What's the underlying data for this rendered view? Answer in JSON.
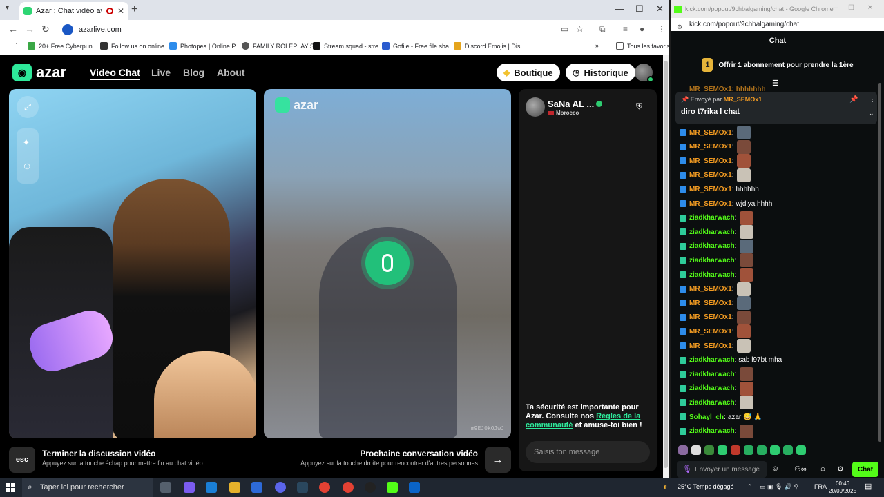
{
  "browser_left": {
    "tab_title": "Azar : Chat vidéo avec de n",
    "url": "azarlive.com",
    "bookmarks": [
      "20+ Free Cyberpun...",
      "Follow us on online...",
      "Photopea | Online P...",
      "FAMILY ROLEPLAY S...",
      "Stream squad - stre...",
      "Gofile - Free file sha...",
      "Discord Emojis | Dis..."
    ],
    "bookmarks_more": "»",
    "all_bookmarks": "Tous les favoris"
  },
  "azar": {
    "logo": "azar",
    "nav": [
      "Video Chat",
      "Live",
      "Blog",
      "About"
    ],
    "shop_label": "Boutique",
    "history_label": "Historique",
    "partner_name": "SaNa AL ...",
    "partner_country": "Morocco",
    "video_code": "m9EJ0kOJwJ",
    "safety_text_1": "Ta sécurité est importante pour Azar. Consulte nos ",
    "safety_link": "Règles de la communauté",
    "safety_text_2": " et amuse-toi bien !",
    "message_placeholder": "Saisis ton message",
    "esc_label": "esc",
    "end_title": "Terminer la discussion vidéo",
    "end_sub": "Appuyez sur la touche échap pour mettre fin au chat vidéo.",
    "next_title": "Prochaine conversation vidéo",
    "next_sub": "Appuyez sur la touche droite pour rencontrer d'autres personnes"
  },
  "browser_right": {
    "window_title": "kick.com/popout/9chbalgaming/chat - Google Chrome",
    "url": "kick.com/popout/9chbalgaming/chat",
    "chat_header": "Chat",
    "sub_badge": "1",
    "sub_offer": "Offrir 1 abonnement pour prendre la 1ère",
    "cut_line": "MR_SEMOx1: hhhhhhh",
    "pinned_by_label": "Envoyé par",
    "pinned_user": "MR_SEMOx1",
    "pinned_text": "diro t7rika l chat",
    "input_placeholder": "Envoyer un message",
    "chat_button": "Chat",
    "messages": [
      {
        "user": "MR_SEMOx1",
        "text": "",
        "emote": true,
        "color": "#f29b22"
      },
      {
        "user": "MR_SEMOx1",
        "text": "",
        "emote": true,
        "color": "#f29b22"
      },
      {
        "user": "MR_SEMOx1",
        "text": "",
        "emote": true,
        "color": "#f29b22"
      },
      {
        "user": "MR_SEMOx1",
        "text": "",
        "emote": true,
        "color": "#f29b22"
      },
      {
        "user": "MR_SEMOx1",
        "text": "hhhhhh",
        "emote": false,
        "color": "#f29b22"
      },
      {
        "user": "MR_SEMOx1",
        "text": "wjdiya hhhh",
        "emote": false,
        "color": "#f29b22"
      },
      {
        "user": "ziadkharwach",
        "text": "",
        "emote": true,
        "color": "#53fc18"
      },
      {
        "user": "ziadkharwach",
        "text": "",
        "emote": true,
        "color": "#53fc18"
      },
      {
        "user": "ziadkharwach",
        "text": "",
        "emote": true,
        "color": "#53fc18"
      },
      {
        "user": "ziadkharwach",
        "text": "",
        "emote": true,
        "color": "#53fc18"
      },
      {
        "user": "ziadkharwach",
        "text": "",
        "emote": true,
        "color": "#53fc18"
      },
      {
        "user": "MR_SEMOx1",
        "text": "",
        "emote": true,
        "color": "#f29b22"
      },
      {
        "user": "MR_SEMOx1",
        "text": "",
        "emote": true,
        "color": "#f29b22"
      },
      {
        "user": "MR_SEMOx1",
        "text": "",
        "emote": true,
        "color": "#f29b22"
      },
      {
        "user": "MR_SEMOx1",
        "text": "",
        "emote": true,
        "color": "#f29b22"
      },
      {
        "user": "MR_SEMOx1",
        "text": "",
        "emote": true,
        "color": "#f29b22"
      },
      {
        "user": "ziadkharwach",
        "text": "sab l97bt mha",
        "emote": false,
        "color": "#53fc18"
      },
      {
        "user": "ziadkharwach",
        "text": "",
        "emote": true,
        "color": "#53fc18"
      },
      {
        "user": "ziadkharwach",
        "text": "",
        "emote": true,
        "color": "#53fc18"
      },
      {
        "user": "ziadkharwach",
        "text": "",
        "emote": true,
        "color": "#53fc18"
      },
      {
        "user": "Sohayl_ch",
        "text": "azar 😅 🙏",
        "emote": false,
        "color": "#53fc18"
      },
      {
        "user": "ziadkharwach",
        "text": "",
        "emote": true,
        "color": "#53fc18"
      }
    ]
  },
  "taskbar": {
    "search_placeholder": "Taper ici pour rechercher",
    "weather": "25°C  Temps dégagé",
    "lang": "FRA",
    "time": "00:46",
    "date": "20/09/2025"
  }
}
